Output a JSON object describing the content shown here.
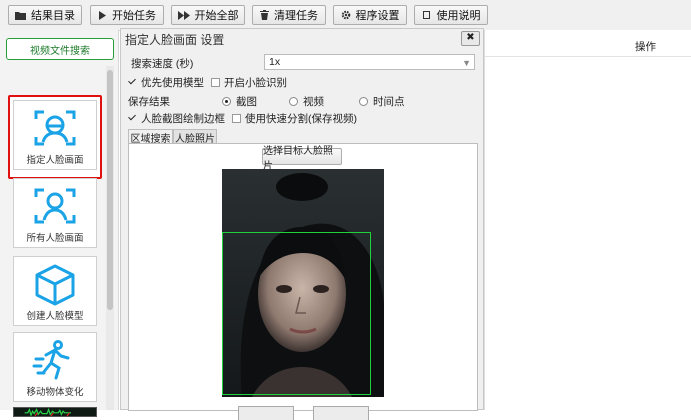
{
  "toolbar": {
    "buttons": [
      {
        "label": "结果目录",
        "icon": "folder-icon"
      },
      {
        "label": "开始任务",
        "icon": "play-icon"
      },
      {
        "label": "开始全部",
        "icon": "fast-forward-icon"
      },
      {
        "label": "清理任务",
        "icon": "trash-icon"
      },
      {
        "label": "程序设置",
        "icon": "gear-icon"
      },
      {
        "label": "使用说明",
        "icon": "book-icon"
      }
    ]
  },
  "sidebar": {
    "search_label": "视频文件搜索",
    "items": [
      {
        "label": "指定人脸画面",
        "icon": "face-scan-icon",
        "selected": true
      },
      {
        "label": "所有人脸画面",
        "icon": "person-scan-icon"
      },
      {
        "label": "创建人脸模型",
        "icon": "cube-icon"
      },
      {
        "label": "移动物体变化",
        "icon": "running-person-icon"
      },
      {
        "label": "",
        "icon": "waveform-icon"
      }
    ]
  },
  "dialog": {
    "title": "指定人脸画面 设置",
    "close_label": "✖",
    "speed_label": "搜索速度 (秒)",
    "speed_value": "1x",
    "opt_model": "优先使用模型",
    "opt_small": "开启小脸识别",
    "save_label": "保存结果",
    "radios": [
      "截图",
      "视频",
      "时间点"
    ],
    "opt_border": "人脸截图绘制边框",
    "opt_fast": "使用快速分割(保存视频)",
    "tabs": [
      "区域搜索",
      "人脸照片"
    ],
    "pick_button": "选择目标人脸照片"
  },
  "right": {
    "column_header": "操作"
  },
  "colors": {
    "accent_green": "#2a9d3a",
    "selection_red": "#e01010",
    "facebox_green": "#1fd13a"
  }
}
